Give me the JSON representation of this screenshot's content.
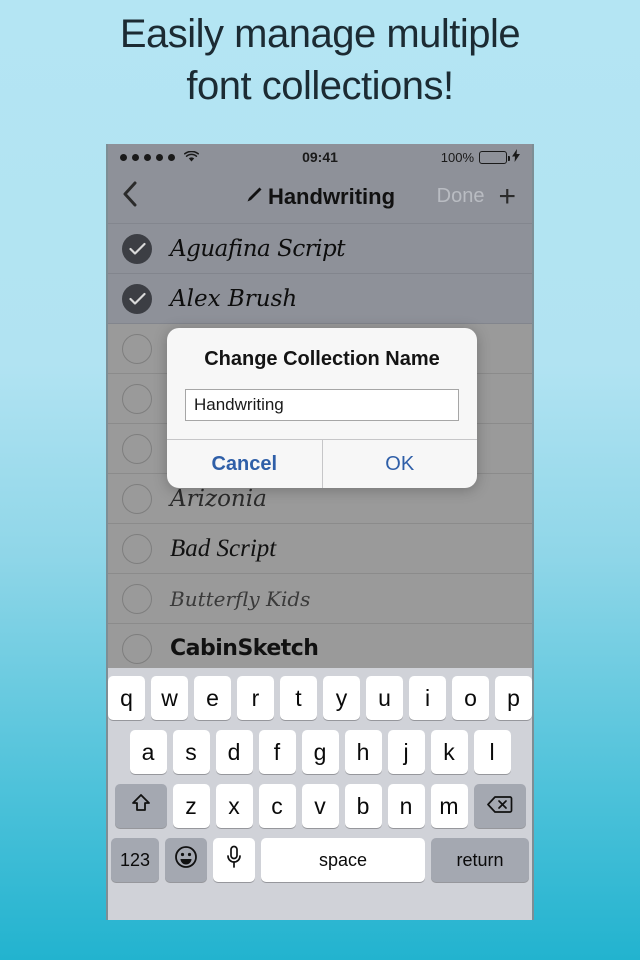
{
  "headline": {
    "line1": "Easily manage multiple",
    "line2": "font collections!"
  },
  "colors": {
    "background_top": "#b4e5f3",
    "background_bottom": "#22b3cf",
    "dimmed_list": "#9a9a9a",
    "selected_row": "#8e9199",
    "dialog_button_blue": "#2f5fa8",
    "battery_green": "#4ce05a"
  },
  "status_bar": {
    "signal_dots": 5,
    "wifi_icon": "wifi-icon",
    "time": "09:41",
    "battery_percent": "100%",
    "battery_icon": "battery-full-icon",
    "charging_icon": "lightning-bolt-icon"
  },
  "nav_bar": {
    "back_icon": "chevron-left-icon",
    "title_icon": "pencil-icon",
    "title": "Handwriting",
    "done_label": "Done",
    "add_icon": "plus-icon"
  },
  "font_list": [
    {
      "name": "Aguafina Script",
      "selected": true,
      "style": "f-script"
    },
    {
      "name": "Alex Brush",
      "selected": true,
      "style": "f-brush"
    },
    {
      "name": "",
      "selected": false,
      "style": "f-blank"
    },
    {
      "name": "",
      "selected": false,
      "style": "f-blank"
    },
    {
      "name": "",
      "selected": false,
      "style": "f-blank"
    },
    {
      "name": "Arizonia",
      "selected": false,
      "style": "f-arizonia"
    },
    {
      "name": "Bad Script",
      "selected": false,
      "style": "f-bad"
    },
    {
      "name": "Butterfly Kids",
      "selected": false,
      "style": "f-butter"
    },
    {
      "name": "CabinSketch",
      "selected": false,
      "style": "f-cabin"
    }
  ],
  "dialog": {
    "title": "Change Collection Name",
    "input_value": "Handwriting",
    "input_placeholder": "",
    "cancel_label": "Cancel",
    "ok_label": "OK"
  },
  "keyboard": {
    "row1": [
      "q",
      "w",
      "e",
      "r",
      "t",
      "y",
      "u",
      "i",
      "o",
      "p"
    ],
    "row2": [
      "a",
      "s",
      "d",
      "f",
      "g",
      "h",
      "j",
      "k",
      "l"
    ],
    "row3": [
      "z",
      "x",
      "c",
      "v",
      "b",
      "n",
      "m"
    ],
    "shift_icon": "shift-arrow-icon",
    "backspace_icon": "backspace-icon",
    "numbers_label": "123",
    "emoji_icon": "smiley-face-icon",
    "mic_icon": "microphone-icon",
    "space_label": "space",
    "return_label": "return"
  }
}
